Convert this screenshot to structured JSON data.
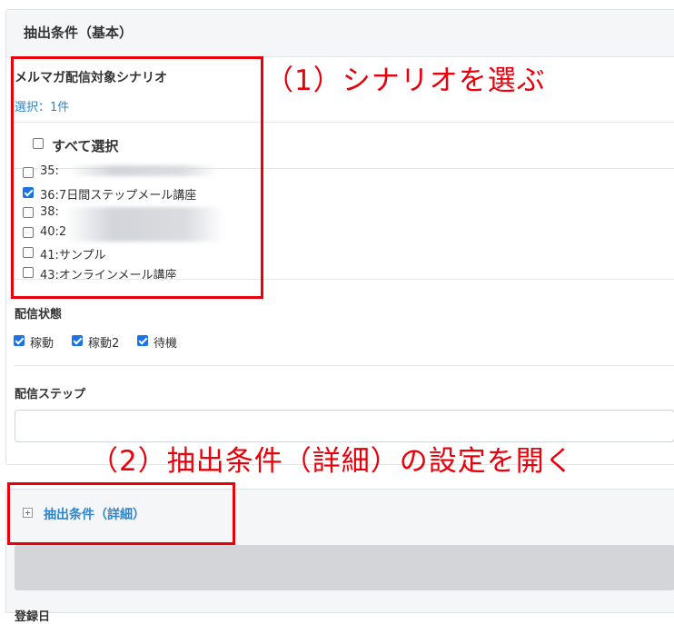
{
  "panel": {
    "title": "抽出条件（基本）"
  },
  "scenario": {
    "label": "メルマガ配信対象シナリオ",
    "selected_count": "選択：1件",
    "select_all_label": "すべて選択",
    "items": [
      {
        "label": "35:",
        "checked": false
      },
      {
        "label": "36:7日間ステップメール講座",
        "checked": true
      },
      {
        "label": "38:",
        "checked": false
      },
      {
        "label": "40:2",
        "checked": false
      },
      {
        "label": "41:サンプル",
        "checked": false
      },
      {
        "label": "43:オンラインメール講座",
        "checked": false
      }
    ]
  },
  "status": {
    "label": "配信状態",
    "options": [
      {
        "label": "稼動",
        "checked": true
      },
      {
        "label": "稼動2",
        "checked": true
      },
      {
        "label": "待機",
        "checked": true
      }
    ]
  },
  "step": {
    "label": "配信ステップ",
    "value": ""
  },
  "annotations": {
    "step1": "（1）シナリオを選ぶ",
    "step2": "（2）抽出条件（詳細）の設定を開く"
  },
  "detail": {
    "title": "抽出条件（詳細）"
  },
  "below": {
    "label": "登録日"
  },
  "colors": {
    "annotation": "#e8000b",
    "link": "#2f86c8",
    "checkbox": "#1a73e8"
  },
  "icons": {
    "expand": "plus-square-icon"
  }
}
